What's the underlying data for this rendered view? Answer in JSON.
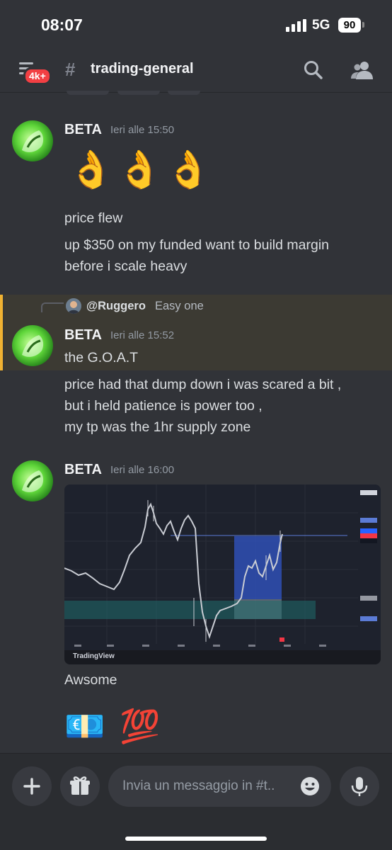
{
  "status": {
    "time": "08:07",
    "network": "5G",
    "battery": "90"
  },
  "header": {
    "badge": "4k+",
    "channel": "trading-general"
  },
  "messages": [
    {
      "username": "BETA",
      "timestamp": "Ieri alle 15:50",
      "emojis": "👌👌👌",
      "lines": [
        "price flew",
        "up $350 on my funded want to build margin",
        "before i scale heavy"
      ]
    },
    {
      "reply": {
        "user": "@Ruggero",
        "text": "Easy one"
      },
      "username": "BETA",
      "timestamp": "Ieri alle 15:52",
      "lines": [
        "the G.O.A.T",
        "price had that dump down i was scared a bit ,",
        "but i held patience is power too ,",
        "my tp was the 1hr supply  zone"
      ]
    },
    {
      "username": "BETA",
      "timestamp": "Ieri alle 16:00",
      "attachment": {
        "watermark": "TradingView"
      },
      "lines": [
        "Awsome"
      ],
      "emojis": "💶 💯"
    }
  ],
  "input": {
    "placeholder": "Invia un messaggio in #t.."
  },
  "colors": {
    "background": "#313338",
    "input_bar": "#2b2d31",
    "reply_highlight": "#3c3a33",
    "reply_border": "#f0b232",
    "badge": "#f23f43"
  }
}
